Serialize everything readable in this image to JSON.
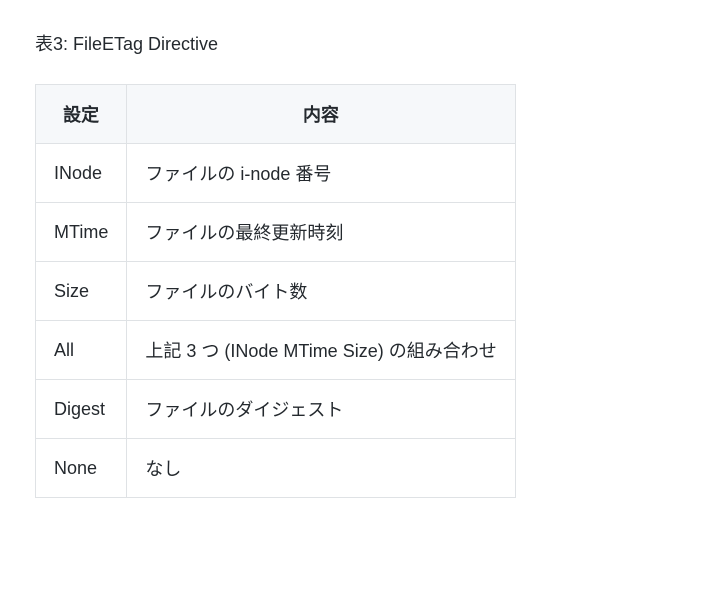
{
  "caption": "表3: FileETag Directive",
  "headers": {
    "setting": "設定",
    "description": "内容"
  },
  "rows": [
    {
      "setting": "INode",
      "description": "ファイルの i-node 番号"
    },
    {
      "setting": "MTime",
      "description": "ファイルの最終更新時刻"
    },
    {
      "setting": "Size",
      "description": "ファイルのバイト数"
    },
    {
      "setting": "All",
      "description": "上記 3 つ (INode MTime Size) の組み合わせ"
    },
    {
      "setting": "Digest",
      "description": "ファイルのダイジェスト"
    },
    {
      "setting": "None",
      "description": "なし"
    }
  ]
}
